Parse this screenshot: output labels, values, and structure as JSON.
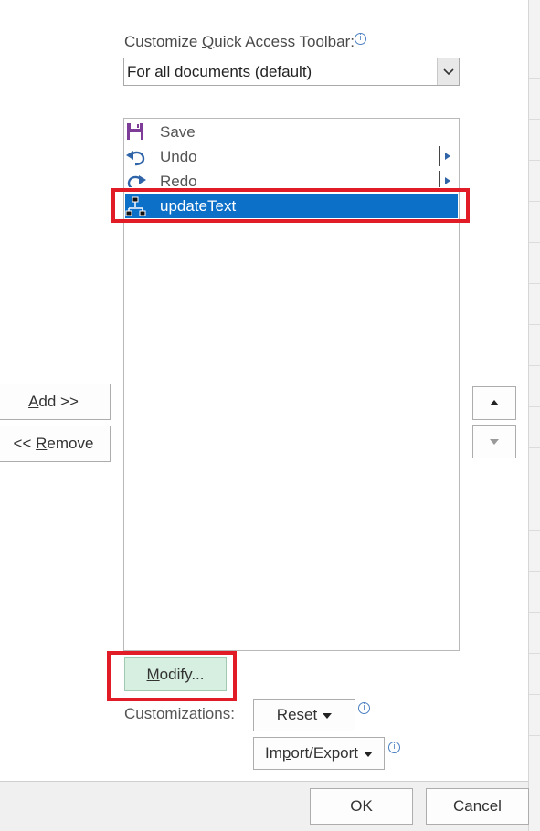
{
  "header": {
    "label": "Customize Quick Access Toolbar:",
    "label_prefix": "Customize ",
    "label_accel": "Q",
    "label_suffix": "uick Access Toolbar:"
  },
  "scope_select": {
    "value": "For all documents (default)"
  },
  "commands": [
    {
      "label": "Save",
      "icon": "save-icon",
      "has_submenu": false,
      "selected": false
    },
    {
      "label": "Undo",
      "icon": "undo-icon",
      "has_submenu": true,
      "selected": false
    },
    {
      "label": "Redo",
      "icon": "redo-icon",
      "has_submenu": true,
      "selected": false
    },
    {
      "label": "updateText",
      "icon": "macro-icon",
      "has_submenu": false,
      "selected": true
    }
  ],
  "buttons": {
    "add_accel": "A",
    "add_rest": "dd >>",
    "remove_prefix": "<< ",
    "remove_accel": "R",
    "remove_rest": "emove",
    "modify_accel": "M",
    "modify_rest": "odify...",
    "reset_prefix": "R",
    "reset_accel": "e",
    "reset_rest": "set",
    "import_prefix": "Im",
    "import_accel": "p",
    "import_rest": "ort/Export",
    "ok": "OK",
    "cancel": "Cancel"
  },
  "customizations_label": "Customizations:",
  "info_glyph": "i",
  "colors": {
    "selection": "#0c6fc8",
    "highlight": "#e11c26",
    "modify_bg": "#d6efe0"
  }
}
